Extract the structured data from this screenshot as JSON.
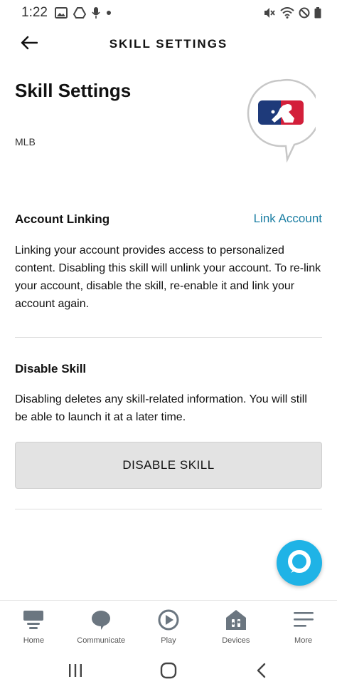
{
  "status_bar": {
    "time": "1:22",
    "left_icons": [
      "gallery-icon",
      "drive-icon",
      "microphone-icon",
      "dot-icon"
    ],
    "right_icons": [
      "mute-icon",
      "wifi-icon",
      "do-not-disturb-icon",
      "battery-icon"
    ]
  },
  "header": {
    "title": "SKILL SETTINGS",
    "back_icon": "back-arrow-icon"
  },
  "skill": {
    "page_title": "Skill Settings",
    "name": "MLB",
    "logo": "mlb-logo"
  },
  "account_linking": {
    "heading": "Account Linking",
    "link_label": "Link Account",
    "description": "Linking your account provides access to personalized content. Disabling this skill will unlink your account. To re-link your account, disable the skill, re-enable it and link your account again."
  },
  "disable_skill": {
    "heading": "Disable Skill",
    "description": "Disabling deletes any skill-related information. You will still be able to launch it at a later time.",
    "button_label": "DISABLE SKILL"
  },
  "alexa_button": {
    "icon": "alexa-icon"
  },
  "bottom_nav": {
    "items": [
      {
        "label": "Home",
        "icon": "home-icon"
      },
      {
        "label": "Communicate",
        "icon": "chat-icon"
      },
      {
        "label": "Play",
        "icon": "play-icon"
      },
      {
        "label": "Devices",
        "icon": "devices-icon"
      },
      {
        "label": "More",
        "icon": "menu-icon"
      }
    ]
  },
  "system_nav": {
    "buttons": [
      "recent-apps-icon",
      "home-circle-icon",
      "back-chevron-icon"
    ]
  },
  "colors": {
    "link": "#1b7ea3",
    "alexa": "#1fb3e6",
    "button_bg": "#e3e3e3",
    "mlb_blue": "#1e3a7a",
    "mlb_red": "#d31f3a"
  }
}
